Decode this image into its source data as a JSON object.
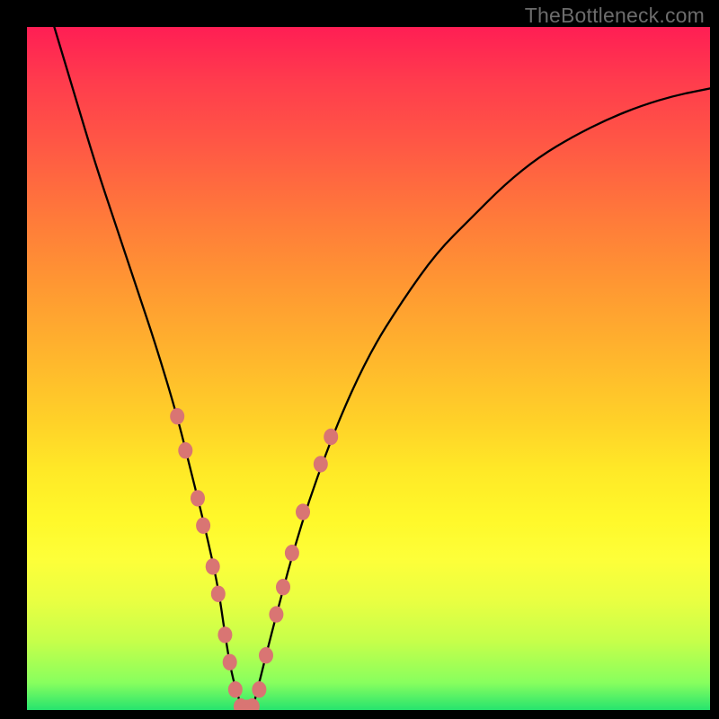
{
  "watermark": "TheBottleneck.com",
  "chart_data": {
    "type": "line",
    "title": "",
    "xlabel": "",
    "ylabel": "",
    "xlim": [
      0,
      100
    ],
    "ylim": [
      0,
      100
    ],
    "series": [
      {
        "name": "bottleneck-curve",
        "color": "#000000",
        "x": [
          4,
          7,
          10,
          13,
          16,
          19,
          22,
          24,
          26,
          28,
          29,
          30,
          31.5,
          33,
          34,
          36,
          40,
          45,
          50,
          55,
          60,
          65,
          70,
          75,
          80,
          85,
          90,
          95,
          100
        ],
        "y": [
          100,
          90,
          80,
          71,
          62,
          53,
          43,
          35,
          27,
          18,
          11,
          5,
          0,
          0,
          4,
          12,
          27,
          41,
          52,
          60,
          67,
          72,
          77,
          81,
          84,
          86.5,
          88.5,
          90,
          91
        ]
      }
    ],
    "markers": {
      "name": "highlight-points",
      "color": "#d97573",
      "radius_px": 8,
      "points": [
        {
          "x": 22.0,
          "y": 43
        },
        {
          "x": 23.2,
          "y": 38
        },
        {
          "x": 25.0,
          "y": 31
        },
        {
          "x": 25.8,
          "y": 27
        },
        {
          "x": 27.2,
          "y": 21
        },
        {
          "x": 28.0,
          "y": 17
        },
        {
          "x": 29.0,
          "y": 11
        },
        {
          "x": 29.7,
          "y": 7
        },
        {
          "x": 30.5,
          "y": 3
        },
        {
          "x": 31.3,
          "y": 0.5
        },
        {
          "x": 32.2,
          "y": 0.3
        },
        {
          "x": 33.0,
          "y": 0.5
        },
        {
          "x": 34.0,
          "y": 3
        },
        {
          "x": 35.0,
          "y": 8
        },
        {
          "x": 36.5,
          "y": 14
        },
        {
          "x": 37.5,
          "y": 18
        },
        {
          "x": 38.8,
          "y": 23
        },
        {
          "x": 40.4,
          "y": 29
        },
        {
          "x": 43.0,
          "y": 36
        },
        {
          "x": 44.5,
          "y": 40
        }
      ]
    },
    "background": {
      "type": "vertical-gradient",
      "stops": [
        {
          "pos": 0,
          "color": "#ff1e54"
        },
        {
          "pos": 50,
          "color": "#ffc828"
        },
        {
          "pos": 78,
          "color": "#fdff39"
        },
        {
          "pos": 100,
          "color": "#26e46e"
        }
      ]
    }
  }
}
